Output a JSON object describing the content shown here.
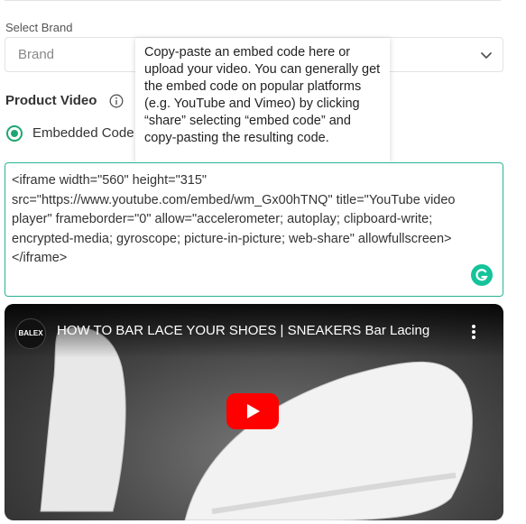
{
  "form": {
    "select_brand_label": "Select Brand",
    "brand_placeholder": "Brand",
    "product_video_label": "Product Video",
    "radio_embedded_label": "Embedded Code"
  },
  "tooltip": {
    "text": "Copy-paste an embed code here or upload your video. You can generally get the embed code on popular platforms (e.g. YouTube and Vimeo) by clicking “share” selecting “embed code” and copy-pasting the resulting code."
  },
  "embed": {
    "code": "<iframe width=\"560\" height=\"315\" src=\"https://www.youtube.com/embed/wm_Gx00hTNQ\" title=\"YouTube video player\" frameborder=\"0\" allow=\"accelerometer; autoplay; clipboard-write; encrypted-media; gyroscope; picture-in-picture; web-share\" allowfullscreen></iframe>"
  },
  "video": {
    "channel": "BALEX",
    "title": "HOW TO BAR LACE YOUR SHOES | SNEAKERS Bar Lacing"
  },
  "colors": {
    "accent": "#1ea672",
    "border_focus": "#2bb296",
    "youtube_red": "#ff0000",
    "grammarly": "#15c39a"
  },
  "icons": [
    "chevron-down-icon",
    "info-icon",
    "grammarly-icon",
    "youtube-play-icon",
    "more-vertical-icon"
  ]
}
